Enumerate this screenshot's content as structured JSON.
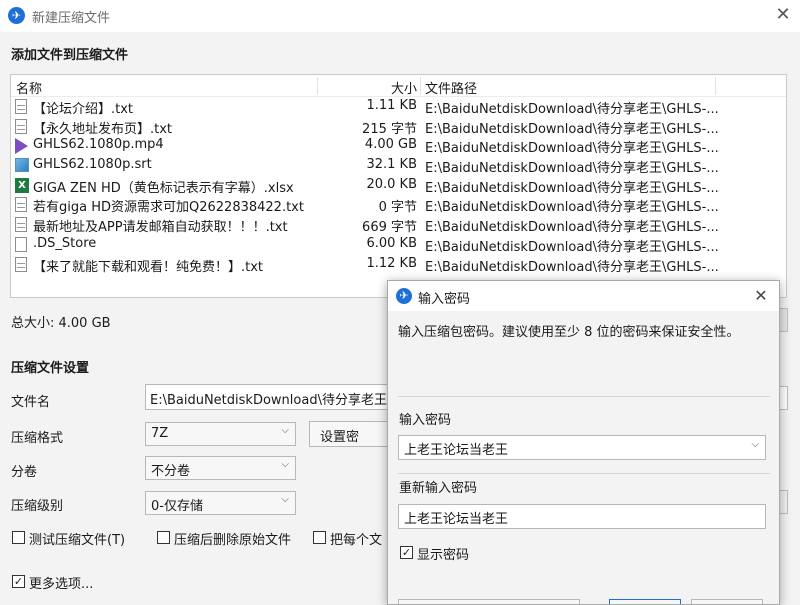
{
  "window": {
    "title": "新建压缩文件",
    "close_glyph": "✕",
    "icon": "baidu-netdisk-icon"
  },
  "add_section": {
    "heading": "添加文件到压缩文件",
    "columns": {
      "name": "名称",
      "size": "大小",
      "path": "文件路径"
    },
    "files": [
      {
        "icon": "txt",
        "name": "【论坛介绍】.txt",
        "size": "1.11 KB",
        "path": "E:\\BaiduNetdiskDownload\\待分享老王\\GHLS-..."
      },
      {
        "icon": "txt",
        "name": "【永久地址发布页】.txt",
        "size": "215 字节",
        "path": "E:\\BaiduNetdiskDownload\\待分享老王\\GHLS-..."
      },
      {
        "icon": "mp4",
        "name": "GHLS62.1080p.mp4",
        "size": "4.00 GB",
        "path": "E:\\BaiduNetdiskDownload\\待分享老王\\GHLS-..."
      },
      {
        "icon": "srt",
        "name": "GHLS62.1080p.srt",
        "size": "32.1 KB",
        "path": "E:\\BaiduNetdiskDownload\\待分享老王\\GHLS-..."
      },
      {
        "icon": "xlsx",
        "name": "GIGA ZEN HD（黄色标记表示有字幕）.xlsx",
        "size": "20.0 KB",
        "path": "E:\\BaiduNetdiskDownload\\待分享老王\\GHLS-..."
      },
      {
        "icon": "txt",
        "name": "若有giga HD资源需求可加Q2622838422.txt",
        "size": "0 字节",
        "path": "E:\\BaiduNetdiskDownload\\待分享老王\\GHLS-..."
      },
      {
        "icon": "txt",
        "name": "最新地址及APP请发邮箱自动获取！！！.txt",
        "size": "669 字节",
        "path": "E:\\BaiduNetdiskDownload\\待分享老王\\GHLS-..."
      },
      {
        "icon": "blank",
        "name": ".DS_Store",
        "size": "6.00 KB",
        "path": "E:\\BaiduNetdiskDownload\\待分享老王\\GHLS-..."
      },
      {
        "icon": "txt",
        "name": "【来了就能下载和观看！纯免费！】.txt",
        "size": "1.12 KB",
        "path": "E:\\BaiduNetdiskDownload\\待分享老王\\GHLS-..."
      }
    ],
    "total_label": "总大小: 4.00 GB"
  },
  "settings": {
    "heading": "压缩文件设置",
    "filename_label": "文件名",
    "filename_value": "E:\\BaiduNetdiskDownload\\待分享老王\\G",
    "format_label": "压缩格式",
    "format_value": "7Z",
    "set_password_button": "设置密",
    "split_label": "分卷",
    "split_value": "不分卷",
    "level_label": "压缩级别",
    "level_value": "0-仅存储",
    "test_checkbox": "测试压缩文件(T)",
    "delete_checkbox": "压缩后删除原始文件",
    "each_checkbox": "把每个文",
    "more_options": "更多选项..."
  },
  "password_dialog": {
    "title": "输入密码",
    "close_glyph": "✕",
    "description": "输入压缩包密码。建议使用至少 8 位的密码来保证安全性。",
    "password_label": "输入密码",
    "password_value": "上老王论坛当老王",
    "reenter_label": "重新输入密码",
    "reenter_value": "上老王论坛当老王",
    "show_password_label": "显示密码",
    "show_password_checked": true
  },
  "colors": {
    "accent": "#1f6fd8",
    "background": "#f3f3f3"
  }
}
